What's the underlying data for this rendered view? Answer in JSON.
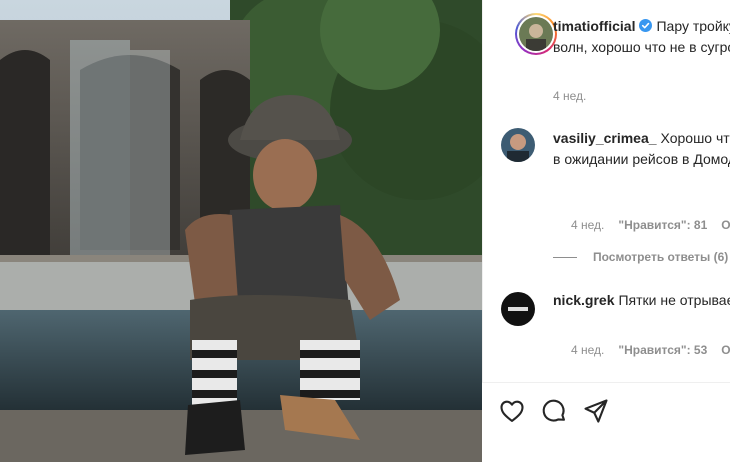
{
  "post": {
    "author": "timatiofficial",
    "caption": "Пару тройку недель в ожидании волн, хорошо что не в сугробах, но и это временно",
    "timestamp": "4 нед."
  },
  "comments": [
    {
      "username": "vasiliy_crimea_",
      "text": "Хорошо что в ожидании волн , а не в ожидании рейсов в Домодедово 😄",
      "timestamp": "4 нед.",
      "likes": "\"Нравится\": 81",
      "reply": "Ответить"
    },
    {
      "username": "nick.grek",
      "text": "Пятки не отрываешь, красавчик бро😊",
      "timestamp": "4 нед.",
      "likes": "\"Нравится\": 53",
      "reply": "Ответить"
    }
  ],
  "view_replies": "Посмотреть ответы (6)",
  "icons": [
    "heart-icon",
    "comment-icon",
    "share-icon"
  ],
  "colors": {
    "verified": "#3897f0",
    "text": "#262626",
    "muted": "#8e8e8e"
  }
}
